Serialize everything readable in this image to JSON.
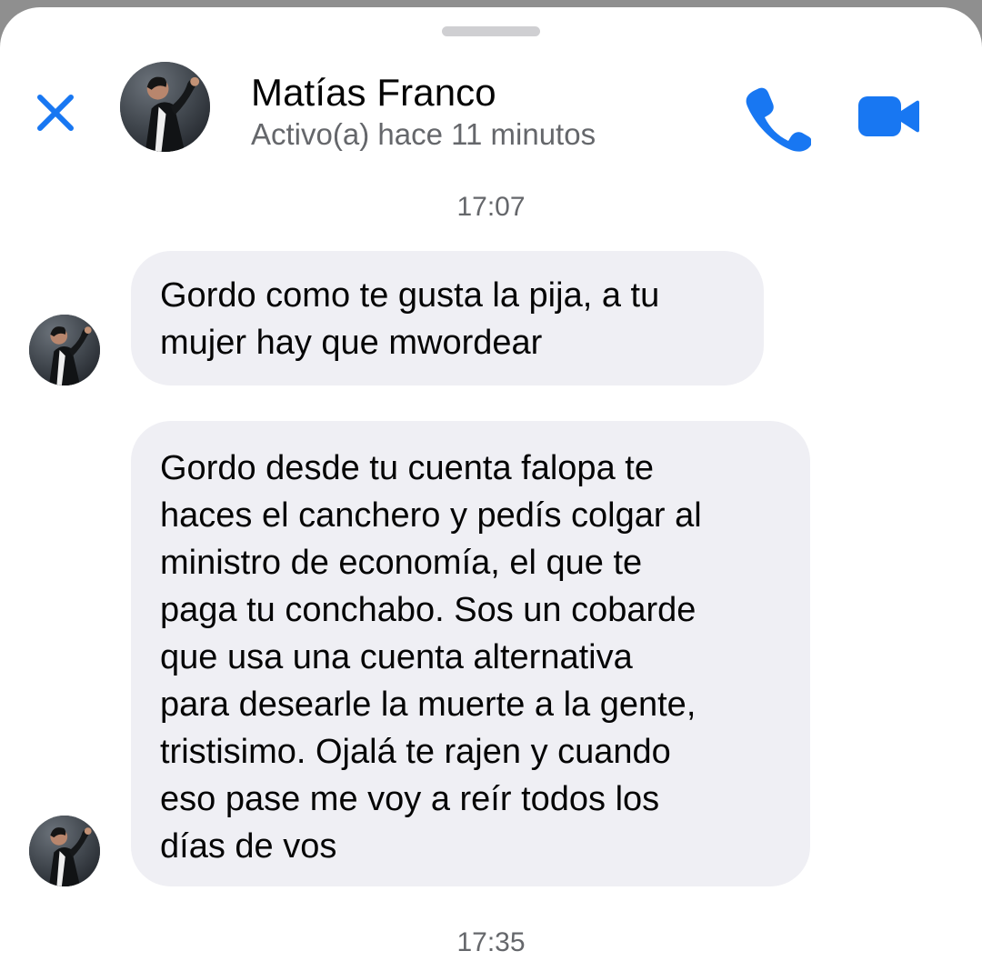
{
  "header": {
    "contact_name": "Matías Franco",
    "status": "Activo(a) hace 11 minutos",
    "avatar_icon": "contact-avatar-icon",
    "call_icon": "phone-icon",
    "video_icon": "video-camera-icon",
    "close_icon": "close-icon"
  },
  "conversation": {
    "timestamps": [
      "17:07",
      "17:35"
    ],
    "messages": [
      {
        "sender": "Matías Franco",
        "lines": [
          "Gordo como te gusta la pija, a tu",
          "mujer hay que mwordear"
        ]
      },
      {
        "sender": "Matías Franco",
        "lines": [
          "Gordo desde tu cuenta falopa te",
          "haces el canchero y pedís colgar al",
          "ministro de economía, el que te",
          "paga tu conchabo. Sos un cobarde",
          "que usa una cuenta alternativa",
          "para desearle la muerte a la gente,",
          "tristisimo. Ojalá te rajen y cuando",
          "eso pase me voy a reír todos los",
          "días de vos"
        ]
      }
    ]
  },
  "colors": {
    "accent": "#1877f2",
    "incoming_bubble": "#efeff4",
    "primary_text": "#050505",
    "secondary_text": "#65676b",
    "background": "#ffffff",
    "drag_handle": "#cfcfd2"
  }
}
